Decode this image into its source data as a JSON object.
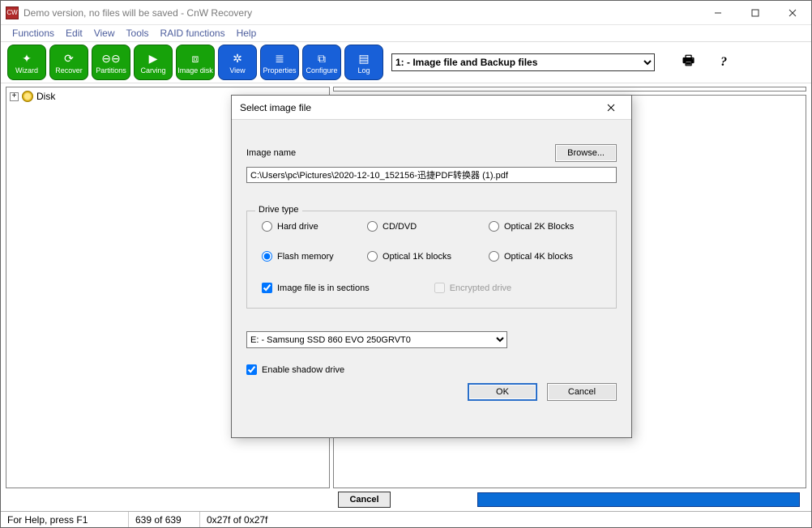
{
  "titlebar": {
    "title": "Demo version, no files will be saved - CnW Recovery"
  },
  "menu": {
    "items": [
      "Functions",
      "Edit",
      "View",
      "Tools",
      "RAID functions",
      "Help"
    ]
  },
  "toolbar": {
    "buttons": [
      {
        "label": "Wizard",
        "name": "wizard-button",
        "color": "green",
        "icon": "✦"
      },
      {
        "label": "Recover",
        "name": "recover-button",
        "color": "green",
        "icon": "⟳"
      },
      {
        "label": "Partitions",
        "name": "partitions-button",
        "color": "green",
        "icon": "⊖⊖"
      },
      {
        "label": "Carving",
        "name": "carving-button",
        "color": "green",
        "icon": "▶"
      },
      {
        "label": "Image disk",
        "name": "imagedisk-button",
        "color": "green",
        "icon": "⧈"
      },
      {
        "label": "View",
        "name": "view-button",
        "color": "blue",
        "icon": "✲"
      },
      {
        "label": "Properties",
        "name": "properties-button",
        "color": "blue",
        "icon": "≣"
      },
      {
        "label": "Configure",
        "name": "configure-button",
        "color": "blue",
        "icon": "⧉"
      },
      {
        "label": "Log",
        "name": "log-button",
        "color": "blue",
        "icon": "▤"
      }
    ],
    "dropdown_value": "1: - Image file and Backup files"
  },
  "tree": {
    "root_label": "Disk"
  },
  "bottom": {
    "cancel_label": "Cancel"
  },
  "statusbar": {
    "help": "For Help, press F1",
    "count": "639 of 639",
    "hex": "0x27f of 0x27f"
  },
  "dialog": {
    "title": "Select image file",
    "image_name_label": "Image name",
    "browse_label": "Browse...",
    "path_value": "C:\\Users\\pc\\Pictures\\2020-12-10_152156-迅捷PDF转换器 (1).pdf",
    "drive_type_legend": "Drive type",
    "radios": {
      "hard_drive": "Hard drive",
      "cd_dvd": "CD/DVD",
      "optical_2k": "Optical 2K Blocks",
      "flash": "Flash memory",
      "optical_1k": "Optical 1K blocks",
      "optical_4k": "Optical 4K blocks"
    },
    "sections_label": "Image file is in sections",
    "encrypted_label": "Encrypted drive",
    "drive_select_value": "E: - Samsung  SSD 860 EVO 250GRVT0",
    "shadow_label": "Enable shadow drive",
    "ok_label": "OK",
    "cancel_label": "Cancel"
  }
}
